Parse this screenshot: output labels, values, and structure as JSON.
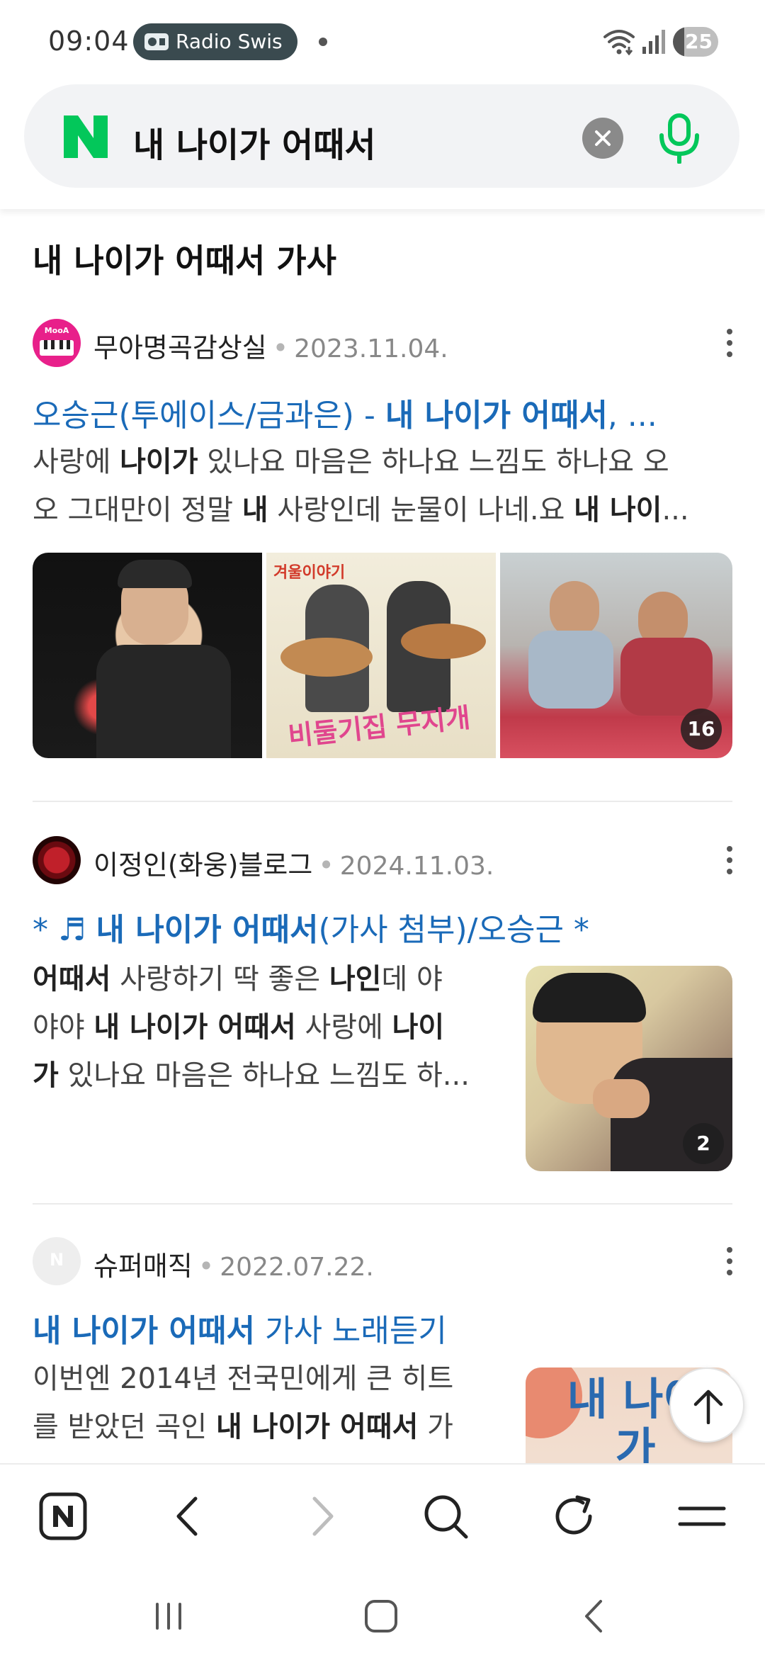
{
  "status_bar": {
    "time": "09:04",
    "media_label": "Radio Swis",
    "battery_level": "25",
    "battery_fraction": 0.25
  },
  "search": {
    "query": "내 나이가 어때서",
    "logo_letter": "N"
  },
  "section_title": "내 나이가 어때서 가사",
  "results": [
    {
      "blog_name": "무아명곡감상실",
      "avatar_text": "MooA",
      "date": "2023.11.04.",
      "title_parts": [
        {
          "text": "오승근(투에이스/금과은) - ",
          "bold": false
        },
        {
          "text": "내 나이가 어때서",
          "bold": true
        },
        {
          "text": ", ...",
          "bold": false
        }
      ],
      "snippet_lines": [
        [
          {
            "text": "사랑에 ",
            "bold": false
          },
          {
            "text": "나이가",
            "bold": true
          },
          {
            "text": " 있나요 마음은 하나요 느낌도 하나요 오",
            "bold": false
          }
        ],
        [
          {
            "text": "오 그대만이 정말 ",
            "bold": false
          },
          {
            "text": "내",
            "bold": true
          },
          {
            "text": " 사랑인데 눈물이 나네.요 ",
            "bold": false
          },
          {
            "text": "내 나이",
            "bold": true
          },
          {
            "text": "...",
            "bold": false
          }
        ]
      ],
      "thumb_texts": [
        "겨울이야기",
        "비둘기집 무지개"
      ],
      "image_count": "16"
    },
    {
      "blog_name": "이정인(화웅)블로그",
      "date": "2024.11.03.",
      "title_parts": [
        {
          "text": "* ",
          "bold": false
        },
        {
          "text": "♬ ",
          "bold": false
        },
        {
          "text": "내 나이가 어때서",
          "bold": true
        },
        {
          "text": "(가사 첨부)/오승근 *",
          "bold": false
        }
      ],
      "snippet_lines": [
        [
          {
            "text": "어때서",
            "bold": true
          },
          {
            "text": " 사랑하기 딱 좋은 ",
            "bold": false
          },
          {
            "text": "나인",
            "bold": true
          },
          {
            "text": "데 야",
            "bold": false
          }
        ],
        [
          {
            "text": "야야 ",
            "bold": false
          },
          {
            "text": "내 나이가 어때서",
            "bold": true
          },
          {
            "text": " 사랑에 ",
            "bold": false
          },
          {
            "text": "나이",
            "bold": true
          }
        ],
        [
          {
            "text": "가",
            "bold": true
          },
          {
            "text": " 있나요 마음은 하나요 느낌도 하...",
            "bold": false
          }
        ]
      ],
      "image_count": "2"
    },
    {
      "blog_name": "슈퍼매직",
      "avatar_text": "N",
      "date": "2022.07.22.",
      "title_parts": [
        {
          "text": "내 나이가 어때서",
          "bold": true
        },
        {
          "text": " 가사 노래듣기",
          "bold": false
        }
      ],
      "snippet_lines": [
        [
          {
            "text": "이번엔 2014년 전국민에게 큰 히트",
            "bold": false
          }
        ],
        [
          {
            "text": "를 받았던 곡인 ",
            "bold": false
          },
          {
            "text": "내 나이가 어때서",
            "bold": true
          },
          {
            "text": " 가",
            "bold": false
          }
        ]
      ],
      "thumb_text": "내 나이가"
    }
  ],
  "icons": {
    "clear": "clear-icon",
    "mic": "microphone-icon",
    "more": "more-vertical-icon",
    "scroll_top": "arrow-up-icon",
    "nav": [
      "naver-home-icon",
      "back-arrow-icon",
      "forward-arrow-icon",
      "search-icon",
      "refresh-icon",
      "menu-icon"
    ],
    "system": [
      "recent-apps-icon",
      "home-icon",
      "system-back-icon"
    ]
  },
  "colors": {
    "naver_green": "#03c75a",
    "link_blue": "#1a6ab8",
    "date_gray": "#888888"
  }
}
